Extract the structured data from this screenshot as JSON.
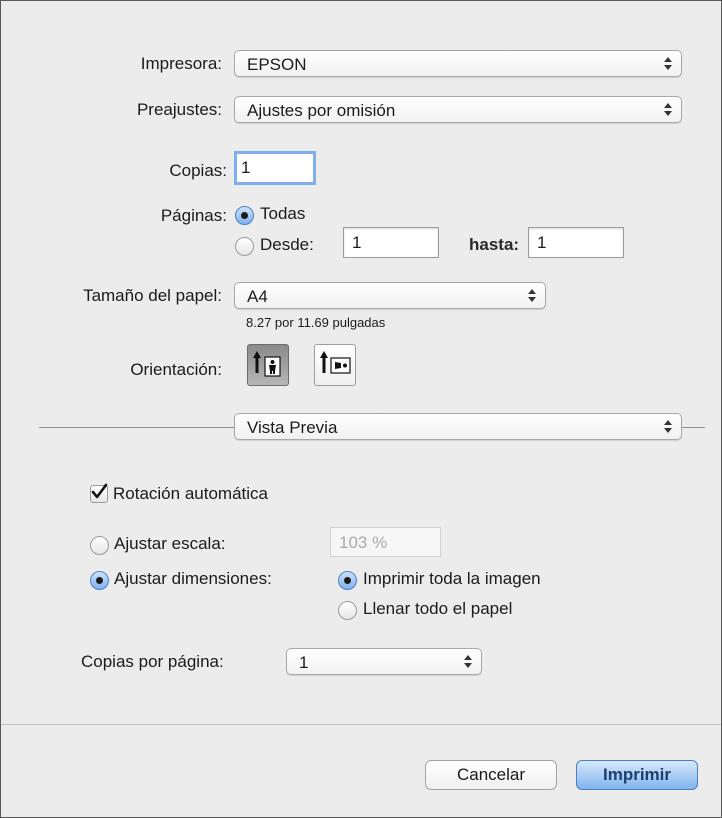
{
  "printer": {
    "label": "Impresora:",
    "value": "EPSON"
  },
  "presets": {
    "label": "Preajustes:",
    "value": "Ajustes por omisión"
  },
  "copies": {
    "label": "Copias:",
    "value": "1"
  },
  "pages": {
    "label": "Páginas:",
    "all_label": "Todas",
    "from_label": "Desde:",
    "from_value": "1",
    "to_label": "hasta:",
    "to_value": "1",
    "selected": "all"
  },
  "paper_size": {
    "label": "Tamaño del papel:",
    "value": "A4",
    "dimensions": "8.27 por 11.69 pulgadas"
  },
  "orientation": {
    "label": "Orientación:",
    "selected": "portrait"
  },
  "section_menu": {
    "value": "Vista Previa"
  },
  "auto_rotate": {
    "label": "Rotación automática",
    "checked": true
  },
  "scale": {
    "label": "Ajustar escala:",
    "value": "103 %",
    "selected": false
  },
  "fit": {
    "label": "Ajustar dimensiones:",
    "selected": true,
    "option_whole_image": "Imprimir toda la imagen",
    "option_fill_paper": "Llenar todo el papel",
    "fit_selected": "whole_image"
  },
  "pages_per_sheet": {
    "label": "Copias por página:",
    "value": "1"
  },
  "buttons": {
    "cancel": "Cancelar",
    "print": "Imprimir"
  },
  "colors": {
    "accent": "#7fb4ee",
    "background": "#ececec"
  }
}
